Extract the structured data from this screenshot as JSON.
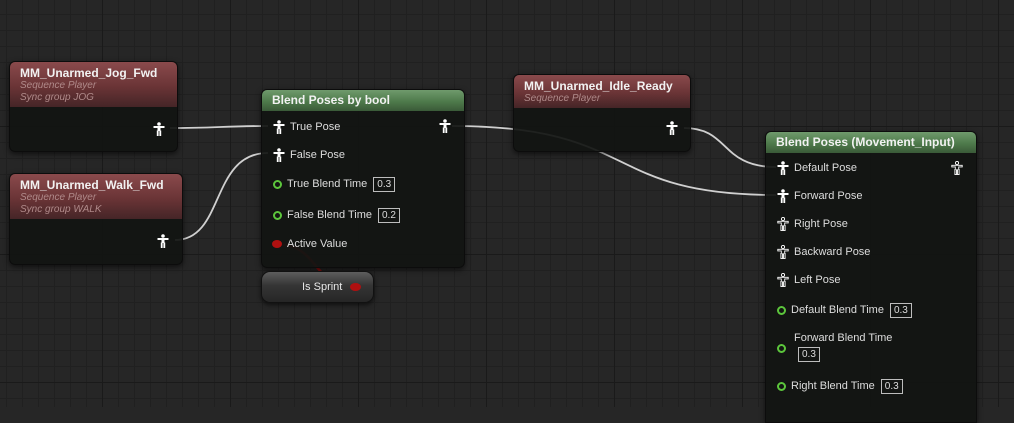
{
  "nodes": {
    "jog": {
      "title": "MM_Unarmed_Jog_Fwd",
      "type": "Sequence Player",
      "sync": "Sync group JOG"
    },
    "walk": {
      "title": "MM_Unarmed_Walk_Fwd",
      "type": "Sequence Player",
      "sync": "Sync group WALK"
    },
    "idle": {
      "title": "MM_Unarmed_Idle_Ready",
      "type": "Sequence Player"
    },
    "blend_bool": {
      "title": "Blend Poses by bool",
      "pins": {
        "true_pose": "True Pose",
        "false_pose": "False Pose",
        "true_blend": "True Blend Time",
        "true_blend_value": "0.3",
        "false_blend": "False Blend Time",
        "false_blend_value": "0.2",
        "active_value": "Active Value"
      }
    },
    "is_sprint": {
      "label": "Is Sprint"
    },
    "blend_movement": {
      "title": "Blend Poses (Movement_Input)",
      "pins": {
        "default_pose": "Default Pose",
        "forward_pose": "Forward Pose",
        "right_pose": "Right Pose",
        "backward_pose": "Backward Pose",
        "left_pose": "Left Pose",
        "default_blend": "Default Blend Time",
        "default_blend_value": "0.3",
        "forward_blend": "Forward Blend Time",
        "forward_blend_value": "0.3",
        "right_blend": "Right Blend Time",
        "right_blend_value": "0.3"
      }
    }
  },
  "colors": {
    "sequence_header": "#6a3436",
    "blend_header": "#4e7a4b",
    "float_pin": "#5cc63c",
    "bool_pin": "#b01010",
    "wire": "#d0d0d0"
  },
  "icons": {
    "pose_pin": "pose-figure-icon",
    "float_pin": "float-ring-icon",
    "bool_pin": "bool-dot-icon"
  }
}
